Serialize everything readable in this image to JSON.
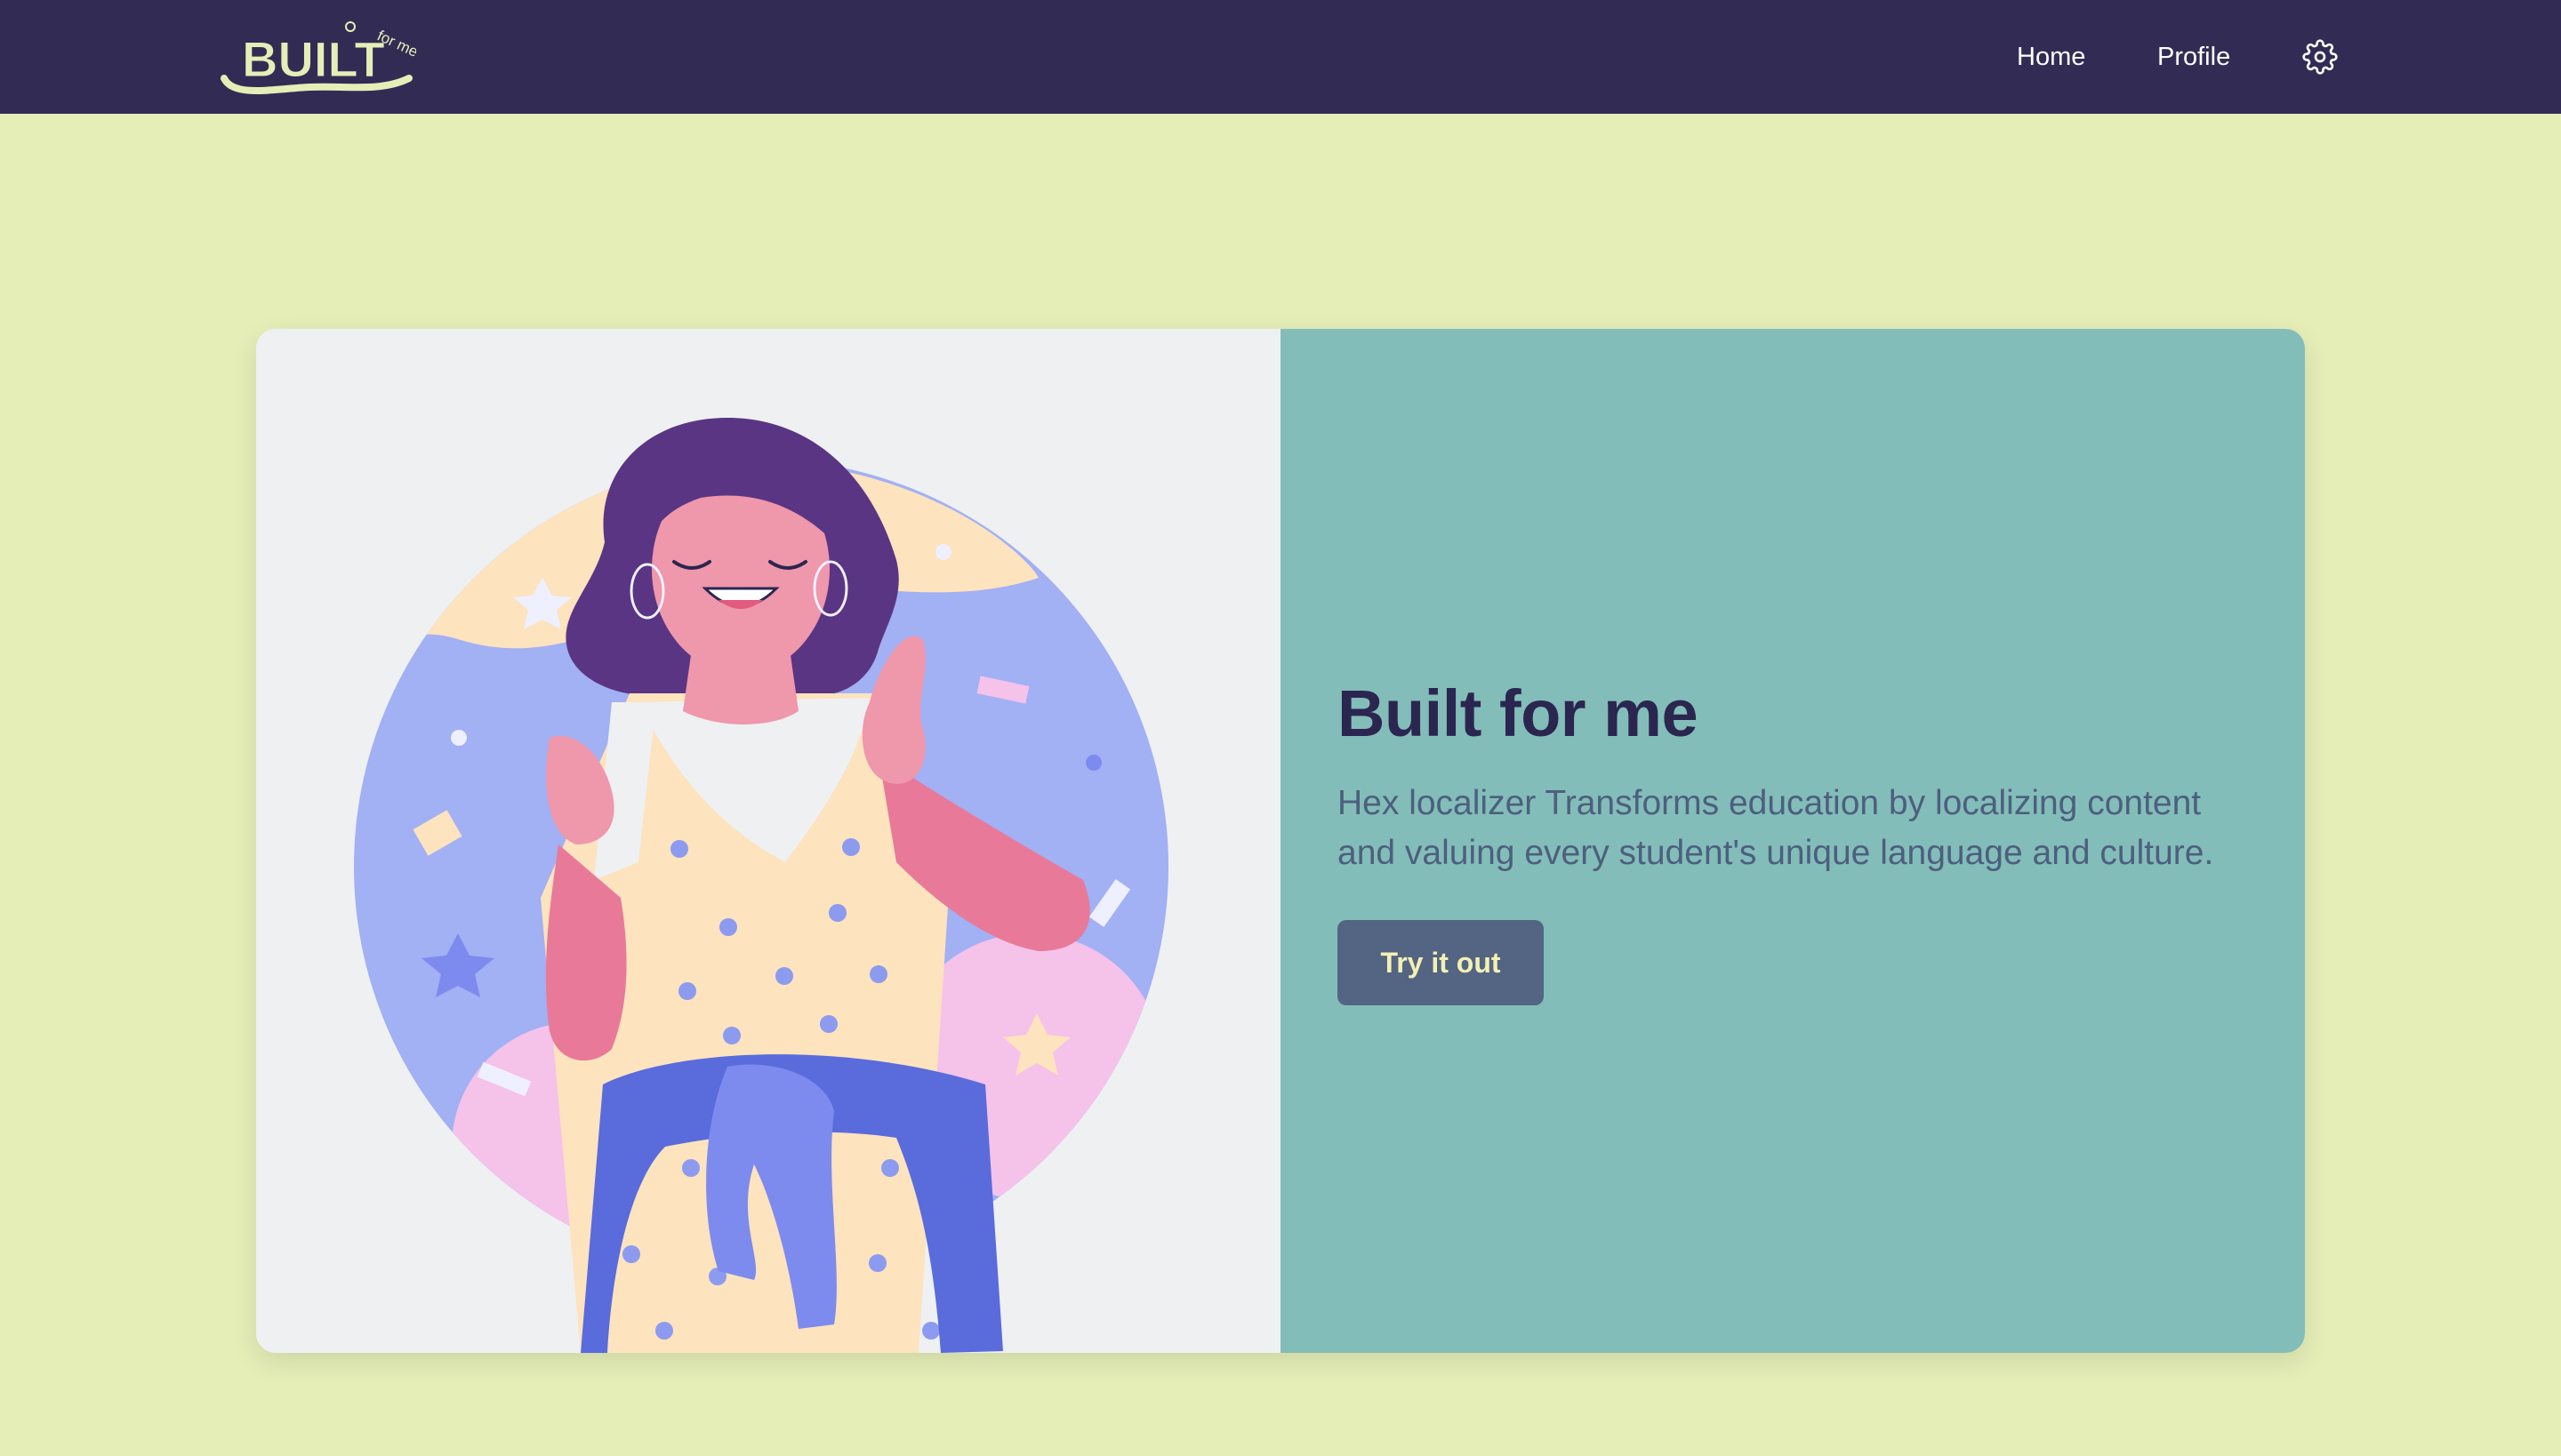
{
  "brand": {
    "logo_text": "BUILT",
    "logo_subtext": "for me"
  },
  "nav": {
    "home_label": "Home",
    "profile_label": "Profile",
    "settings_icon": "gear-icon"
  },
  "hero": {
    "title": "Built for me",
    "description": "Hex localizer Transforms education by localizing content and valuing every student's unique language and culture.",
    "cta_label": "Try it out"
  },
  "colors": {
    "navbar": "#322c55",
    "page_background": "#e5eeb7",
    "panel_teal": "#83bdb9",
    "button": "#536582",
    "button_text": "#f4f0b4",
    "title": "#2b2650"
  }
}
